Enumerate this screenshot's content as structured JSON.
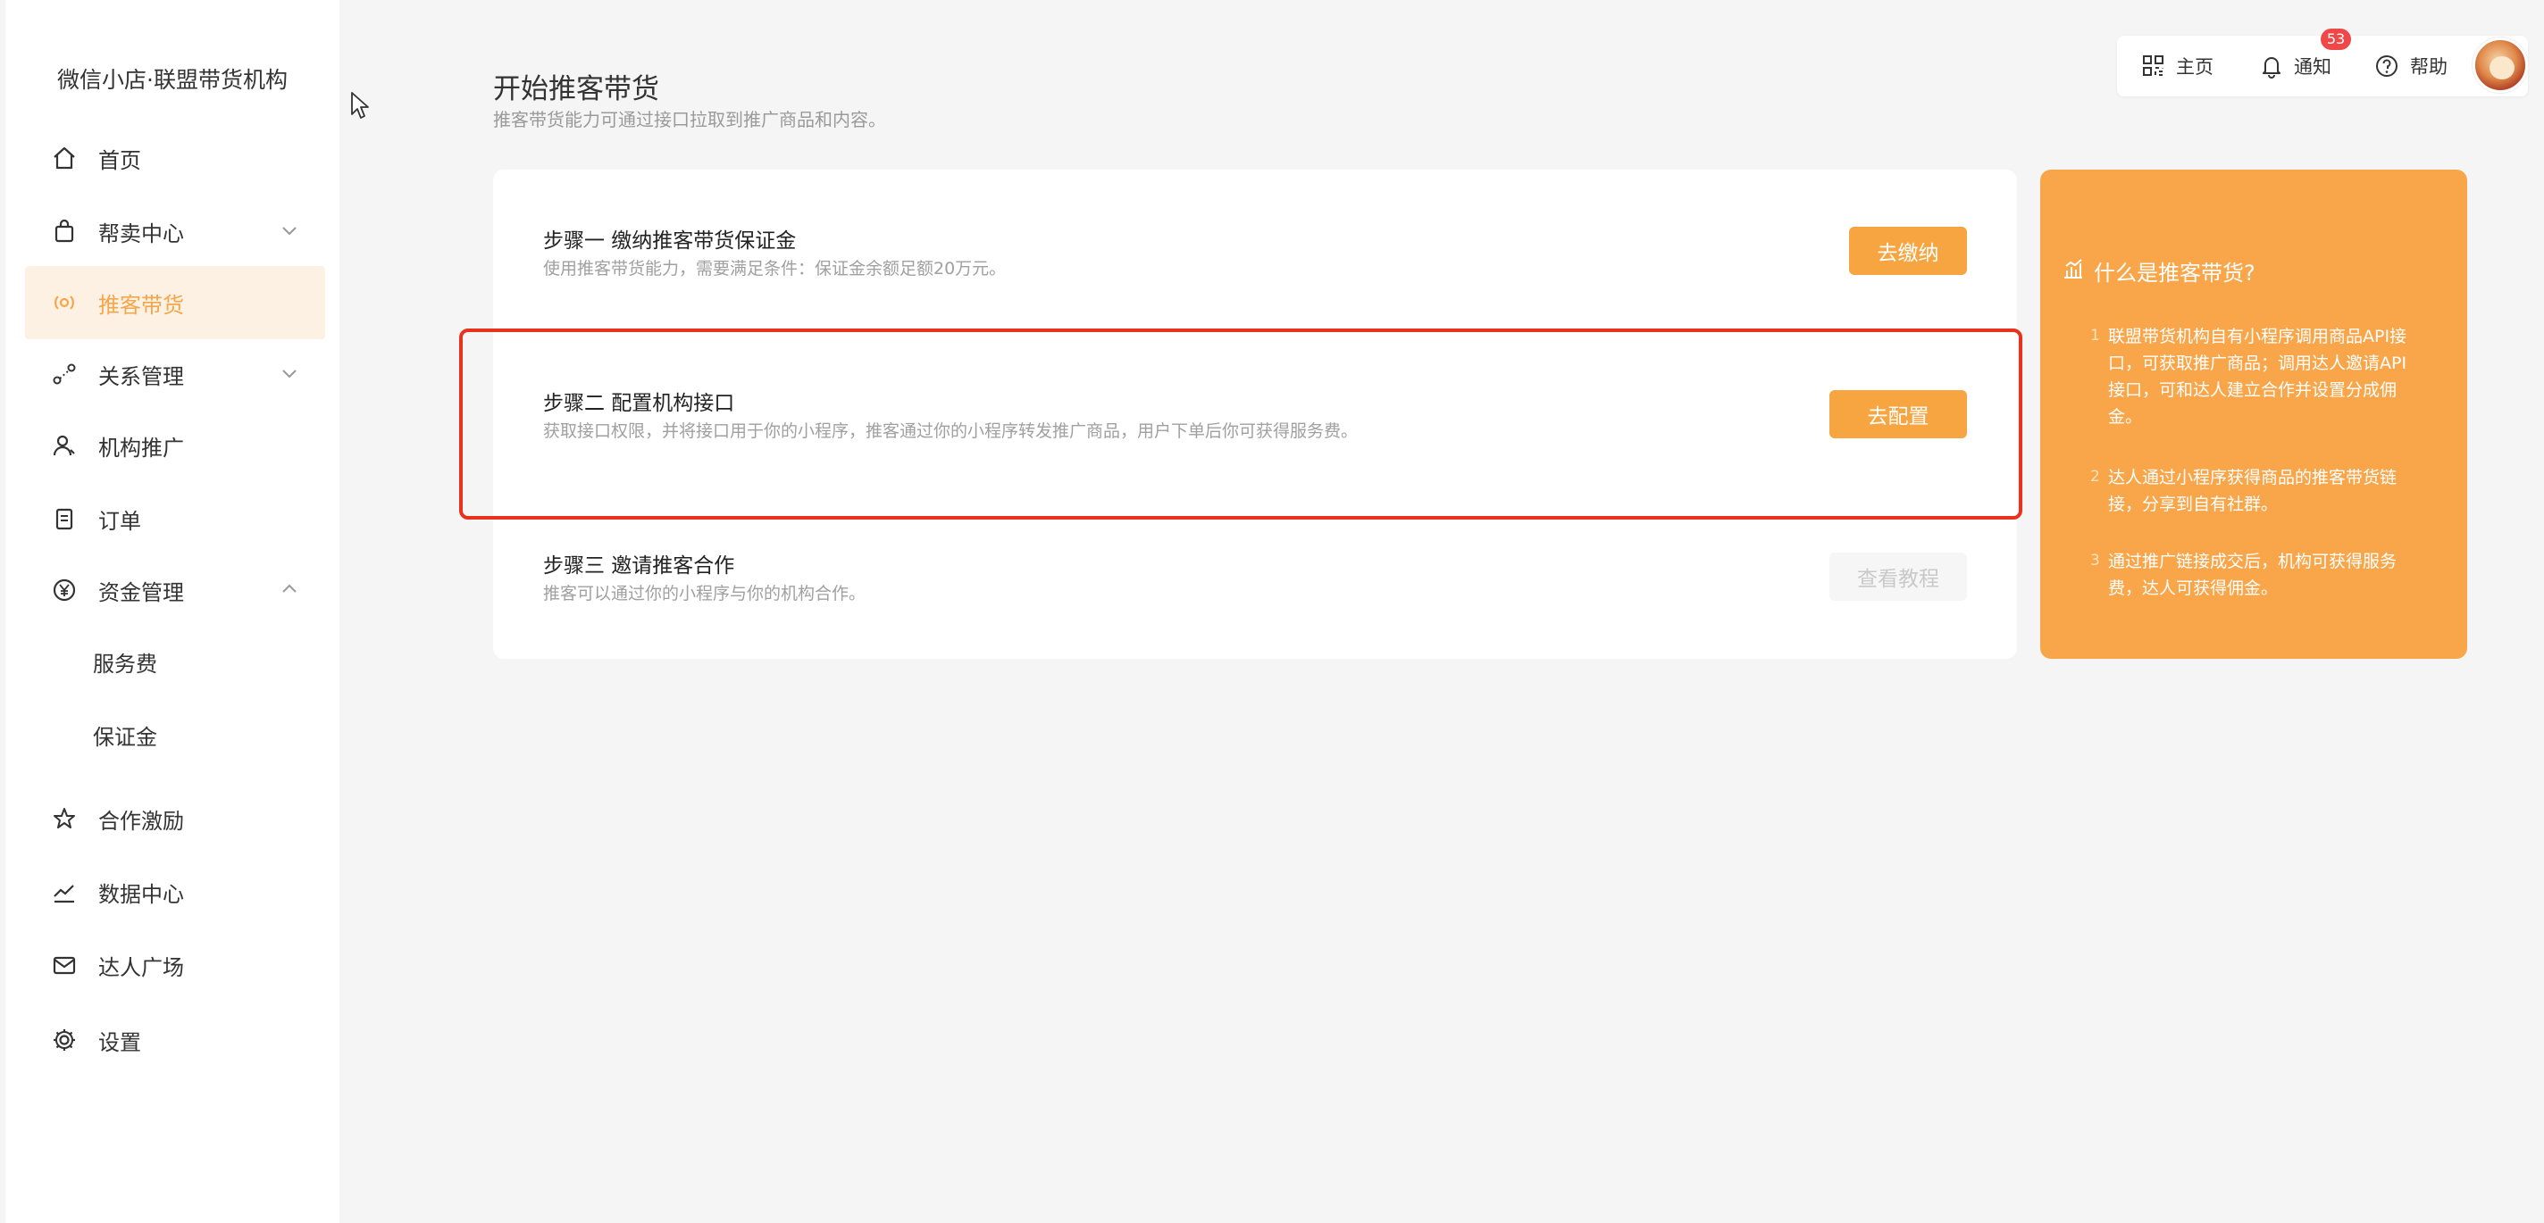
{
  "sidebar": {
    "brand": "微信小店·联盟带货机构",
    "items": [
      {
        "label": "首页"
      },
      {
        "label": "帮卖中心"
      },
      {
        "label": "推客带货"
      },
      {
        "label": "关系管理"
      },
      {
        "label": "机构推广"
      },
      {
        "label": "订单"
      },
      {
        "label": "资金管理"
      },
      {
        "label": "服务费"
      },
      {
        "label": "保证金"
      },
      {
        "label": "合作激励"
      },
      {
        "label": "数据中心"
      },
      {
        "label": "达人广场"
      },
      {
        "label": "设置"
      }
    ]
  },
  "header": {
    "title": "开始推客带货",
    "subtitle": "推客带货能力可通过接口拉取到推广商品和内容。"
  },
  "topbar": {
    "home": "主页",
    "notify": "通知",
    "notify_count": "53",
    "help": "帮助"
  },
  "steps": [
    {
      "title": "步骤一 缴纳推客带货保证金",
      "desc": "使用推客带货能力，需要满足条件：保证金余额足额20万元。",
      "button": "去缴纳"
    },
    {
      "title": "步骤二 配置机构接口",
      "desc": "获取接口权限，并将接口用于你的小程序，推客通过你的小程序转发推广商品，用户下单后你可获得服务费。",
      "button": "去配置"
    },
    {
      "title": "步骤三 邀请推客合作",
      "desc": "推客可以通过你的小程序与你的机构合作。",
      "button": "查看教程"
    }
  ],
  "info": {
    "title": "什么是推客带货?",
    "items": [
      {
        "num": "1",
        "text": "联盟带货机构自有小程序调用商品API接口，可获取推广商品；调用达人邀请API接口，可和达人建立合作并设置分成佣金。"
      },
      {
        "num": "2",
        "text": "达人通过小程序获得商品的推客带货链接，分享到自有社群。"
      },
      {
        "num": "3",
        "text": "通过推广链接成交后，机构可获得服务费，达人可获得佣金。"
      }
    ]
  },
  "colors": {
    "accent": "#f6a540",
    "active_bg": "#fdf1e4",
    "highlight": "#e8321e",
    "info_bg": "#f9a64a"
  }
}
